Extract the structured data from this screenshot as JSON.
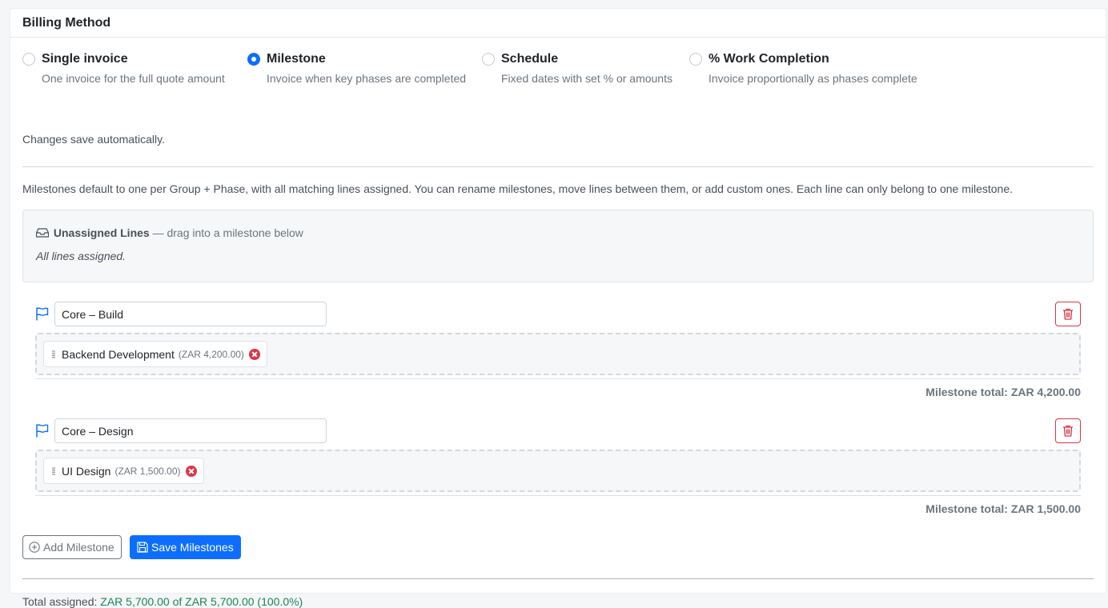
{
  "card": {
    "title": "Billing Method"
  },
  "billing_options": [
    {
      "title": "Single invoice",
      "description": "One invoice for the full quote amount",
      "selected": false
    },
    {
      "title": "Milestone",
      "description": "Invoice when key phases are completed",
      "selected": true
    },
    {
      "title": "Schedule",
      "description": "Fixed dates with set % or amounts",
      "selected": false
    },
    {
      "title": "% Work Completion",
      "description": "Invoice proportionally as phases complete",
      "selected": false
    }
  ],
  "autosave_note": "Changes save automatically.",
  "intro_text": "Milestones default to one per Group + Phase, with all matching lines assigned. You can rename milestones, move lines between them, or add custom ones. Each line can only belong to one milestone.",
  "unassigned": {
    "icon": "inbox-icon",
    "title": "Unassigned Lines",
    "hint": " — drag into a milestone below",
    "empty_text": "All lines assigned."
  },
  "milestones": [
    {
      "name": "Core – Build",
      "lines": [
        {
          "label": "Backend Development",
          "amount": "(ZAR 4,200.00)"
        }
      ],
      "total": "Milestone total: ZAR 4,200.00"
    },
    {
      "name": "Core – Design",
      "lines": [
        {
          "label": "UI Design",
          "amount": "(ZAR 1,500.00)"
        }
      ],
      "total": "Milestone total: ZAR 1,500.00"
    }
  ],
  "actions": {
    "add_label": "Add Milestone",
    "save_label": "Save Milestones"
  },
  "summary": {
    "label": "Total assigned: ",
    "value": "ZAR 5,700.00 of ZAR 5,700.00 (100.0%)"
  },
  "colors": {
    "primary": "#0d6efd",
    "danger": "#dc3545",
    "success": "#198754",
    "muted": "#6c757d"
  }
}
